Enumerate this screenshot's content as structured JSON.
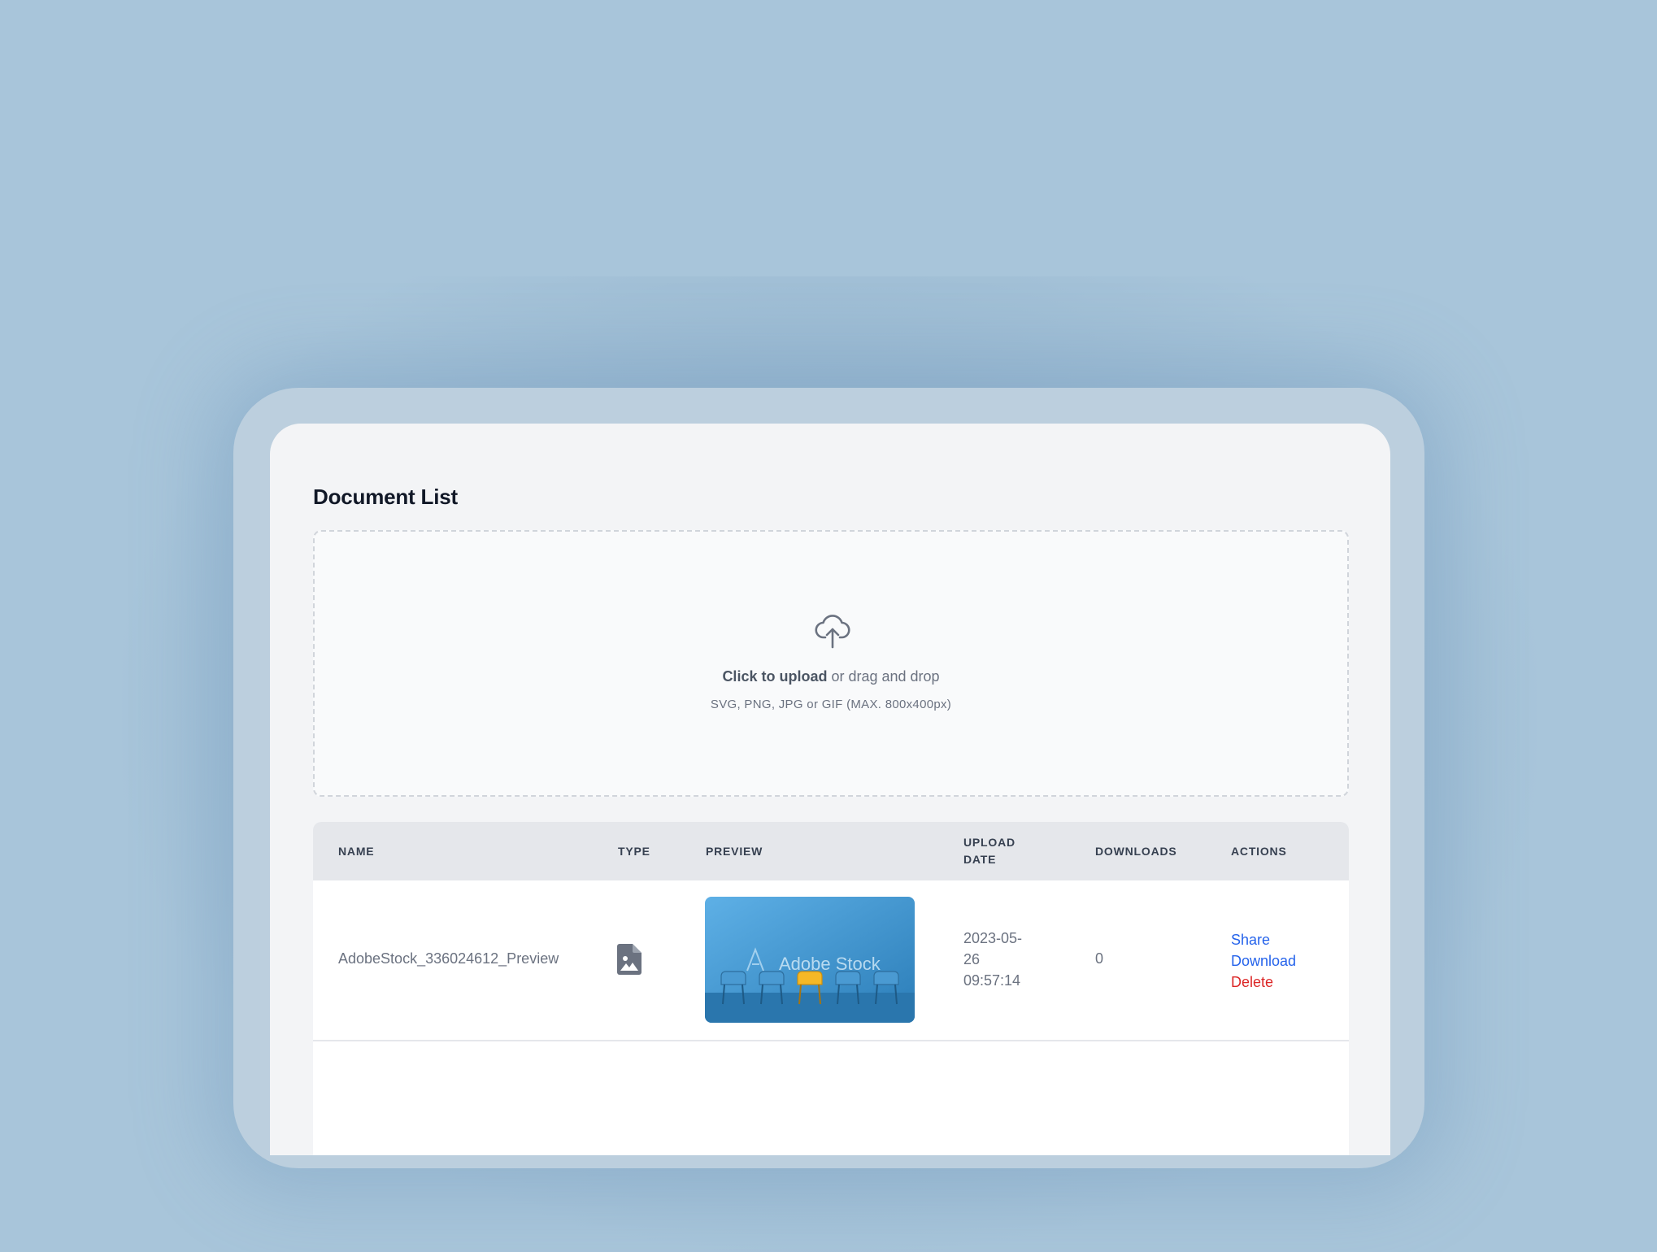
{
  "page": {
    "title": "Document List"
  },
  "upload": {
    "cta_strong": "Click to upload",
    "cta_rest": " or drag and drop",
    "hint": "SVG, PNG, JPG or GIF (MAX. 800x400px)"
  },
  "table": {
    "headers": {
      "name": "NAME",
      "type": "TYPE",
      "preview": "PREVIEW",
      "upload_date_line1": "UPLOAD",
      "upload_date_line2": "DATE",
      "downloads": "DOWNLOADS",
      "actions": "ACTIONS"
    },
    "rows": [
      {
        "name": "AdobeStock_336024612_Preview",
        "type_icon": "image-file-icon",
        "preview_watermark": "Adobe Stock",
        "date_line1": "2023-05-",
        "date_line2": "26",
        "date_line3": "09:57:14",
        "downloads": "0",
        "actions": {
          "share": "Share",
          "download": "Download",
          "delete": "Delete"
        }
      }
    ]
  },
  "colors": {
    "background": "#a8c5da",
    "link": "#2563eb",
    "danger": "#dc2626",
    "header_bg": "#e5e7eb"
  }
}
